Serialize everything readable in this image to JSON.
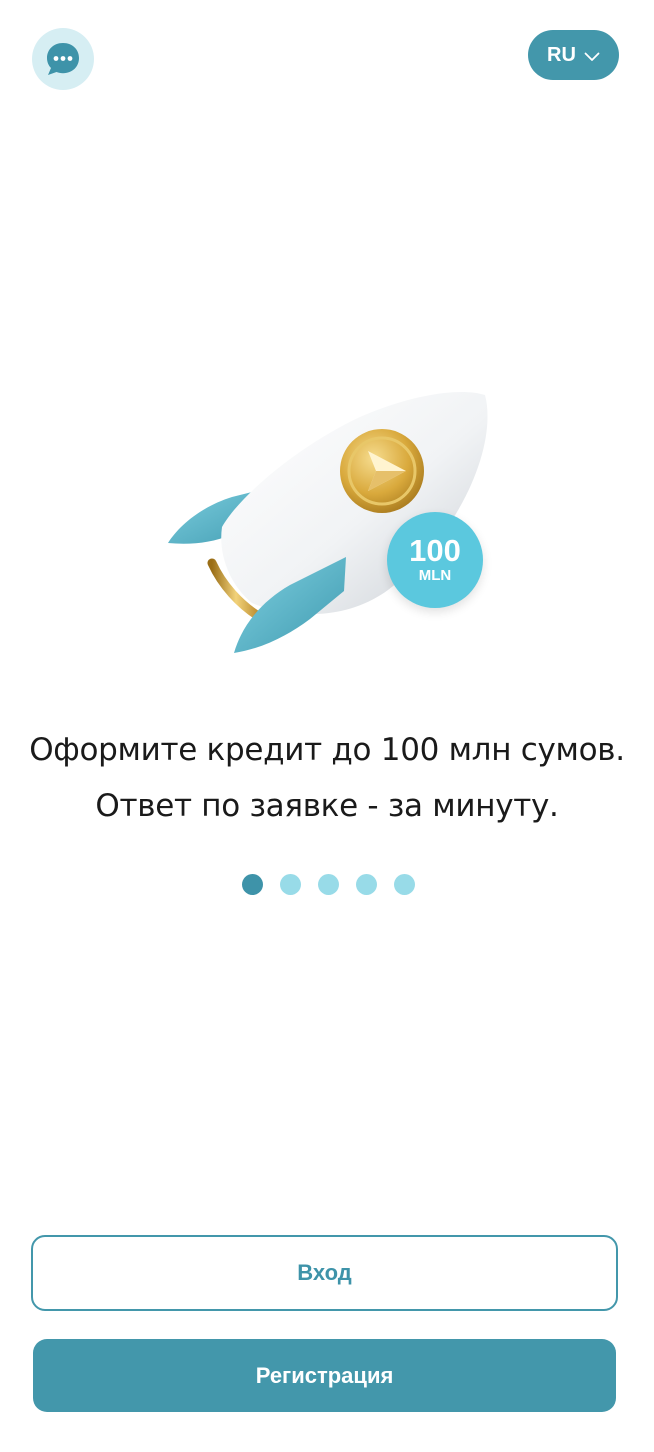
{
  "header": {
    "chat_icon": "chat-bubble-dots-icon",
    "language": "RU",
    "language_chevron_icon": "chevron-down-icon"
  },
  "hero": {
    "badge_number": "100",
    "badge_unit": "MLN",
    "illustration": "rocket-coin-illustration"
  },
  "onboarding": {
    "line1": "Оформите кредит до 100 млн сумов.",
    "line2": "Ответ по заявке - за минуту.",
    "slides_total": 5,
    "active_slide": 1
  },
  "actions": {
    "login_label": "Вход",
    "register_label": "Регистрация"
  },
  "colors": {
    "accent": "#4397ab",
    "dot_inactive": "#98dbe8",
    "chat_bg": "#d6eef3",
    "badge": "#5bc8de"
  }
}
